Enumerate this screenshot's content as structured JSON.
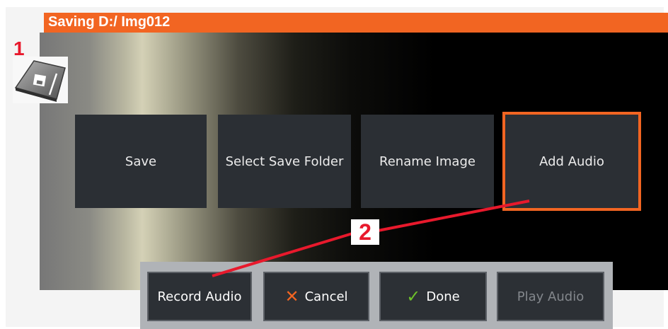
{
  "header": {
    "title": "Saving D:/ Img012"
  },
  "callouts": {
    "one": "1",
    "two": "2"
  },
  "save_icon": {
    "icon": "save-icon"
  },
  "menu": {
    "items": [
      {
        "label": "Save",
        "selected": false
      },
      {
        "label": "Select Save Folder",
        "selected": false
      },
      {
        "label": "Rename Image",
        "selected": false
      },
      {
        "label": "Add Audio",
        "selected": true
      }
    ]
  },
  "toolbar": {
    "record_label": "Record Audio",
    "cancel_label": "Cancel",
    "cancel_icon": "close-icon",
    "done_label": "Done",
    "done_icon": "checkmark-icon",
    "play_label": "Play Audio",
    "play_enabled": false
  },
  "colors": {
    "accent": "#f26522",
    "callout": "#e8192c",
    "button_bg": "#2b2f34",
    "done_check": "#6ec12a"
  }
}
